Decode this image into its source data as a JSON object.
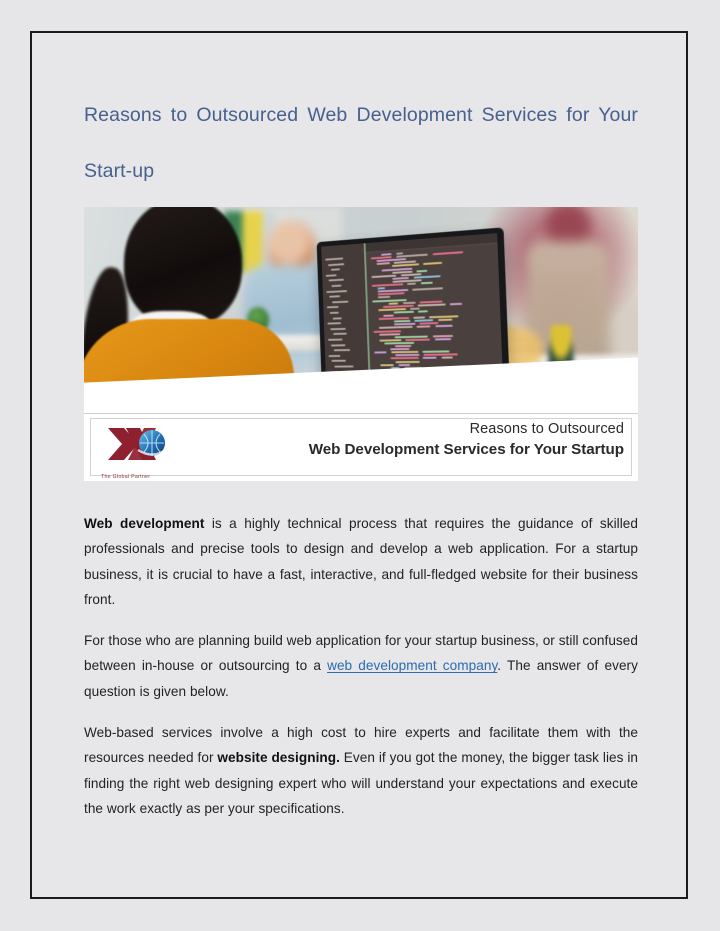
{
  "document": {
    "title_line1": "Reasons to Outsourced Web Development Services for Your",
    "title_line2": "Start-up",
    "title_color": "#47618e"
  },
  "hero": {
    "alt_name": "woman-at-desk-coding-office-photo",
    "banner": {
      "line1": "Reasons to Outsourced",
      "line2": "Web Development Services for Your Startup"
    },
    "logo": {
      "mark": "DX-globe-logo",
      "tagline": "The Global Partner",
      "mark_color": "#8c2franchise"
    }
  },
  "paragraphs": [
    {
      "id": "p1",
      "lead_bold": "Web development",
      "rest": " is a highly technical process that requires the guidance of skilled professionals and precise tools to design and develop a web application. For a startup business, it is crucial to have a fast, interactive, and full-fledged website for their business front."
    },
    {
      "id": "p2",
      "before_link": "For those who are planning build web application for your startup business, or still confused between in-house or outsourcing to a ",
      "link_text": "web development company",
      "after_link": ". The answer of every question is given below.",
      "link_color": "#2a6cb0"
    },
    {
      "id": "p3",
      "before_bold": "Web-based services involve a high cost to hire experts and facilitate them with the resources needed for ",
      "bold_text": "website designing.",
      "after_bold": " Even if you got the money, the bigger task lies in finding the right web designing expert who will understand your expectations and execute the work exactly as per your specifications."
    }
  ],
  "theme": {
    "page_background": "#e6e5e7",
    "sheet_background": "#e7e6e8",
    "sheet_border": "#1b1b1d",
    "body_text_color": "#232323"
  }
}
